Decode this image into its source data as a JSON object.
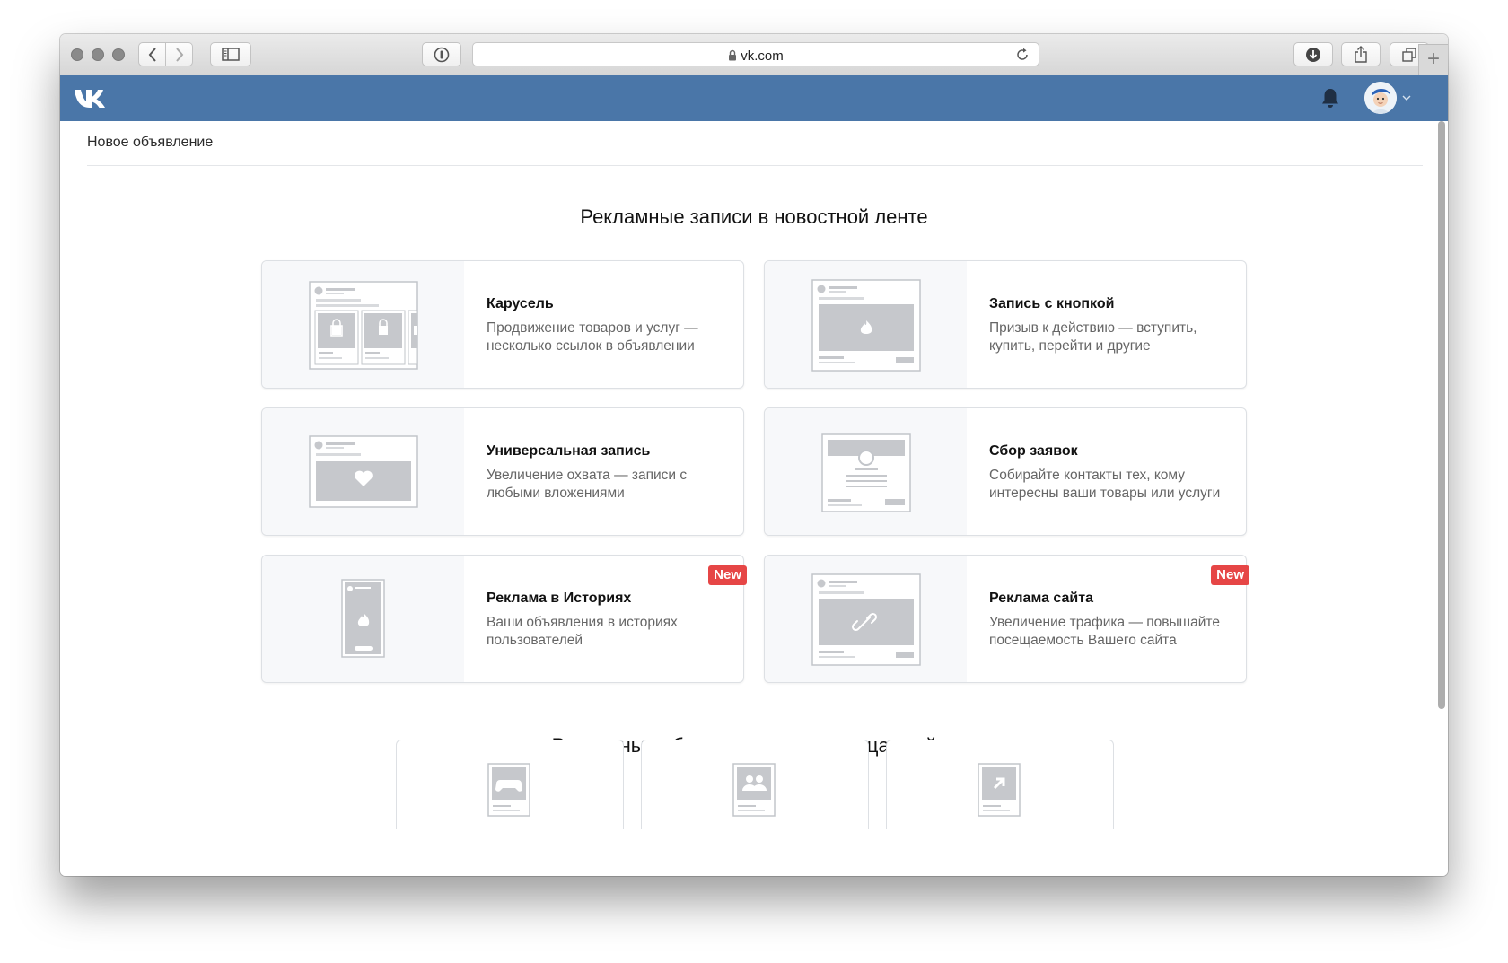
{
  "browser": {
    "url": "vk.com",
    "new_tab": "+"
  },
  "breadcrumb": "Новое объявление",
  "sections": {
    "feed_title": "Рекламные записи в новостной ленте",
    "site_title": "Рекламные объявления на страницах сайта"
  },
  "cards": [
    {
      "title": "Карусель",
      "desc": "Продвижение товаров и услуг — несколько ссылок в объявлении",
      "icon": "carousel-illustration"
    },
    {
      "title": "Запись с кнопкой",
      "desc": "Призыв к действию — вступить, купить, перейти и другие",
      "icon": "button-post-illustration"
    },
    {
      "title": "Универсальная запись",
      "desc": "Увеличение охвата — записи с любыми вложениями",
      "icon": "universal-post-illustration"
    },
    {
      "title": "Сбор заявок",
      "desc": "Собирайте контакты тех, кому интересны ваши товары или услуги",
      "icon": "lead-form-illustration"
    },
    {
      "title": "Реклама в Историях",
      "desc": "Ваши объявления в историях пользователей",
      "badge": "New",
      "icon": "stories-illustration"
    },
    {
      "title": "Реклама сайта",
      "desc": "Увеличение трафика — повышайте посещаемость Вашего сайта",
      "badge": "New",
      "icon": "website-illustration"
    }
  ],
  "mini_cards": [
    {
      "icon": "gamepad-icon"
    },
    {
      "icon": "community-icon"
    },
    {
      "icon": "external-link-icon"
    }
  ],
  "colors": {
    "vk_blue": "#4a76a8",
    "badge_red": "#e64646",
    "placeholder_gray": "#c6c8cc"
  }
}
